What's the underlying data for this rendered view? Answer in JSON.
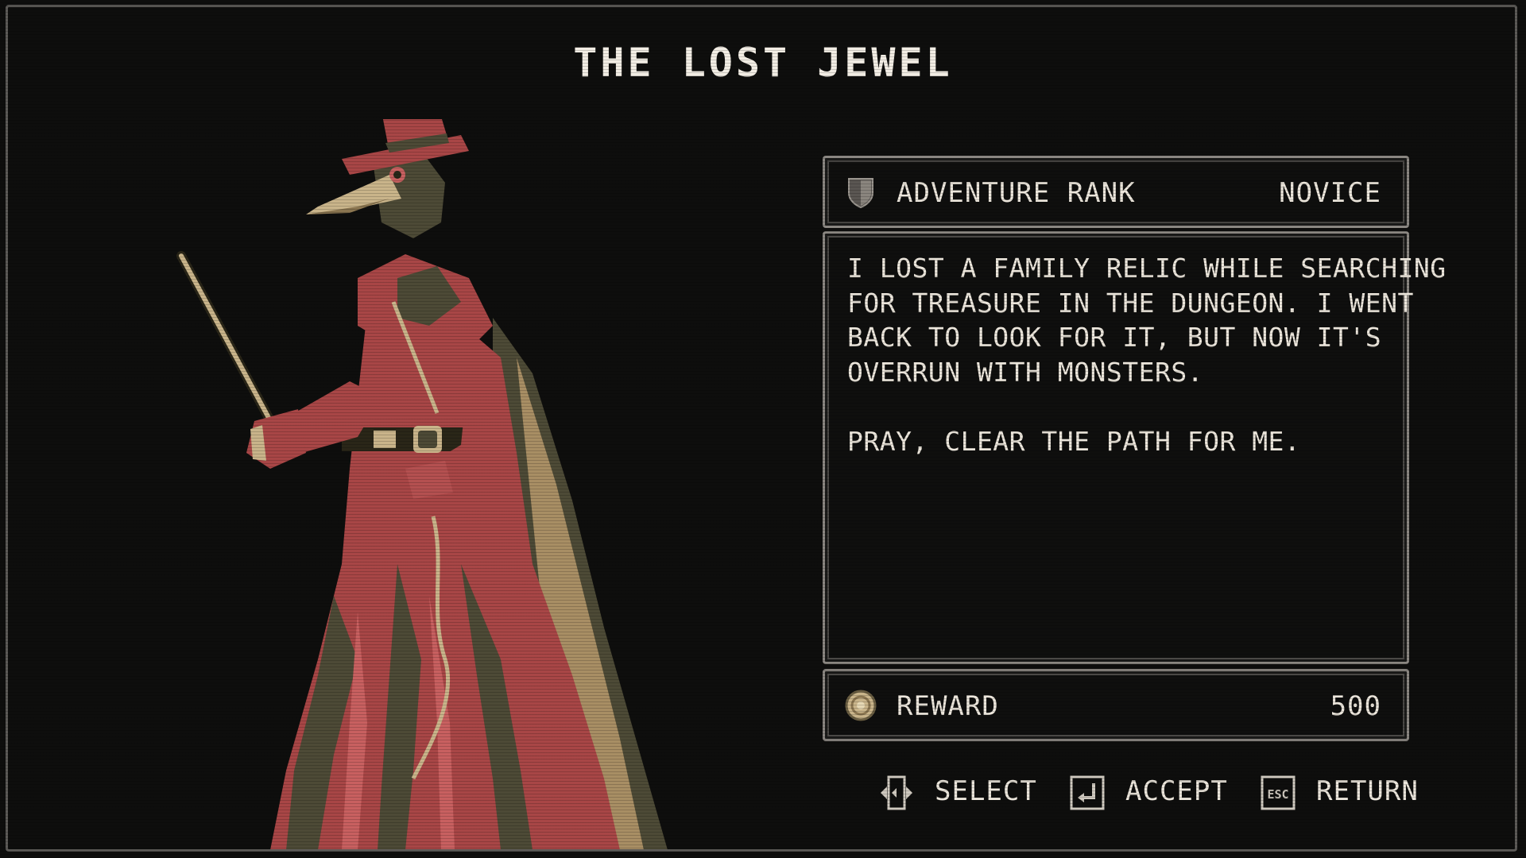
{
  "quest": {
    "title": "THE LOST JEWEL",
    "npc_icon": "plague-doctor-portrait"
  },
  "rank": {
    "icon": "shield-icon",
    "label": "ADVENTURE RANK",
    "value": "NOVICE"
  },
  "description": {
    "lines": [
      "I LOST A FAMILY RELIC WHILE SEARCHING",
      "FOR TREASURE IN THE DUNGEON. I WENT",
      "BACK TO LOOK FOR IT, BUT NOW IT'S",
      "OVERRUN WITH MONSTERS.",
      "",
      "PRAY, CLEAR THE PATH FOR ME."
    ]
  },
  "reward": {
    "icon": "coin-icon",
    "label": "REWARD",
    "value": "500"
  },
  "controls": [
    {
      "icon": "dpad-left-right-icon",
      "label": "SELECT"
    },
    {
      "icon": "enter-key-icon",
      "label": "ACCEPT"
    },
    {
      "icon": "esc-key-icon",
      "label": "RETURN"
    }
  ],
  "colors": {
    "background": "#0e0e0d",
    "text": "#ece6dc",
    "panel_border": "#8a8681",
    "figure_red": "#b04a4a",
    "figure_dark": "#5a5640",
    "figure_tan": "#c9b48a"
  }
}
